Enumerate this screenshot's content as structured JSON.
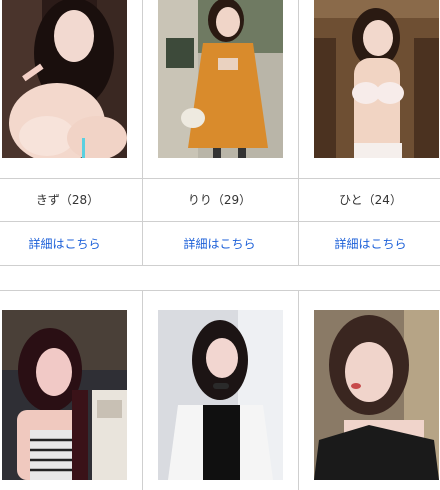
{
  "profiles_row1": [
    {
      "name": "きず（28）",
      "link": "詳細はこちら"
    },
    {
      "name": "りり（29）",
      "link": "詳細はこちら"
    },
    {
      "name": "ひと（24）",
      "link": "詳細はこちら"
    }
  ],
  "colors": {
    "link": "#1b5fd8",
    "border": "#cfcfcf",
    "text": "#333333"
  }
}
